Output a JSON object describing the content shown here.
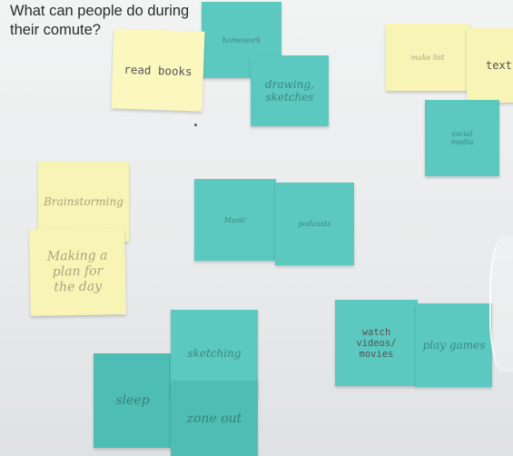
{
  "title": "What can people do during their comute?",
  "notes": {
    "read_books": "read books",
    "homework": "homework",
    "drawing_sketches": "drawing, sketches",
    "make_list": "make list",
    "text": "text",
    "social_media": "social media",
    "brainstorming": "Brainstorming",
    "making_plan": "Making a plan for the day",
    "music": "Music",
    "podcasts": "podcasts",
    "watch_videos": "watch videos/ movies",
    "play_games": "play games",
    "sleep": "sleep",
    "sketching": "sketching",
    "zone_out": "zone out"
  }
}
